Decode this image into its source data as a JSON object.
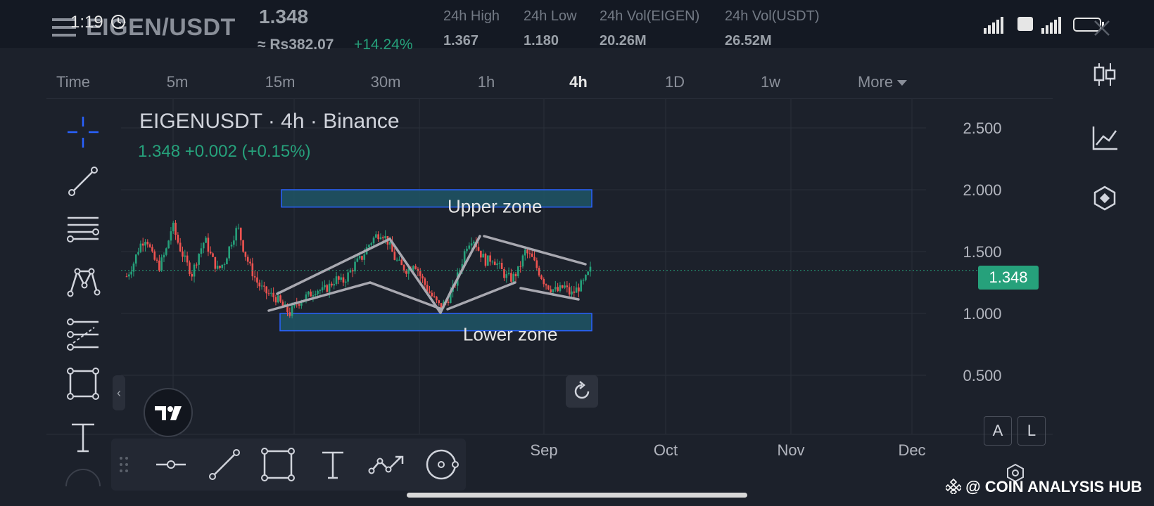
{
  "status_bar": {
    "time": "1:19"
  },
  "header": {
    "pair": "EIGEN/USDT",
    "last_price": "1.348",
    "price_local": "≈ Rs382.07",
    "change_pct": "+14.24%",
    "stats": [
      {
        "label": "24h High",
        "value": "1.367"
      },
      {
        "label": "24h Low",
        "value": "1.180"
      },
      {
        "label": "24h Vol(EIGEN)",
        "value": "20.26M"
      },
      {
        "label": "24h Vol(USDT)",
        "value": "26.52M"
      }
    ]
  },
  "timeframes": [
    {
      "label": "Time",
      "active": false
    },
    {
      "label": "5m",
      "active": false
    },
    {
      "label": "15m",
      "active": false
    },
    {
      "label": "30m",
      "active": false
    },
    {
      "label": "1h",
      "active": false
    },
    {
      "label": "4h",
      "active": true
    },
    {
      "label": "1D",
      "active": false
    },
    {
      "label": "1w",
      "active": false
    },
    {
      "label": "More",
      "active": false
    }
  ],
  "legend": {
    "symbol_line": "EIGENUSDT · 4h · Binance",
    "price_line": "1.348  +0.002 (+0.15%)"
  },
  "chart_data": {
    "type": "candlestick",
    "symbol": "EIGENUSDT",
    "interval": "4h",
    "exchange": "Binance",
    "current_price": 1.348,
    "ylim": [
      0.3,
      2.6
    ],
    "y_ticks": [
      "2.500",
      "2.000",
      "1.500",
      "1.000",
      "0.500"
    ],
    "x_ticks": [
      "Sep",
      "Oct",
      "Nov",
      "Dec"
    ],
    "price_trace": [
      1.3,
      1.4,
      1.55,
      1.62,
      1.45,
      1.38,
      1.5,
      1.72,
      1.55,
      1.42,
      1.32,
      1.48,
      1.6,
      1.45,
      1.35,
      1.42,
      1.58,
      1.7,
      1.5,
      1.36,
      1.25,
      1.18,
      1.15,
      1.12,
      1.05,
      1.0,
      1.08,
      1.12,
      1.15,
      1.2,
      1.18,
      1.22,
      1.28,
      1.25,
      1.32,
      1.4,
      1.45,
      1.55,
      1.62,
      1.66,
      1.58,
      1.45,
      1.38,
      1.35,
      1.42,
      1.3,
      1.2,
      1.12,
      1.05,
      1.1,
      1.2,
      1.35,
      1.55,
      1.62,
      1.5,
      1.42,
      1.45,
      1.38,
      1.3,
      1.28,
      1.35,
      1.5,
      1.45,
      1.35,
      1.25,
      1.2,
      1.18,
      1.22,
      1.15,
      1.2,
      1.25,
      1.35
    ],
    "zones": [
      {
        "name": "Upper zone",
        "low": 1.86,
        "high": 2.0
      },
      {
        "name": "Lower zone",
        "low": 0.86,
        "high": 1.0
      }
    ]
  },
  "price_label": "1.348",
  "buttons": {
    "a_label": "A",
    "l_label": "L"
  },
  "watermark": "@ COIN ANALYSIS HUB",
  "colors": {
    "up": "#26a17b",
    "down": "#ef5350",
    "zone_fill": "#1f5566",
    "zone_border": "#2962ff",
    "pattern_line": "#a8a8b0"
  }
}
